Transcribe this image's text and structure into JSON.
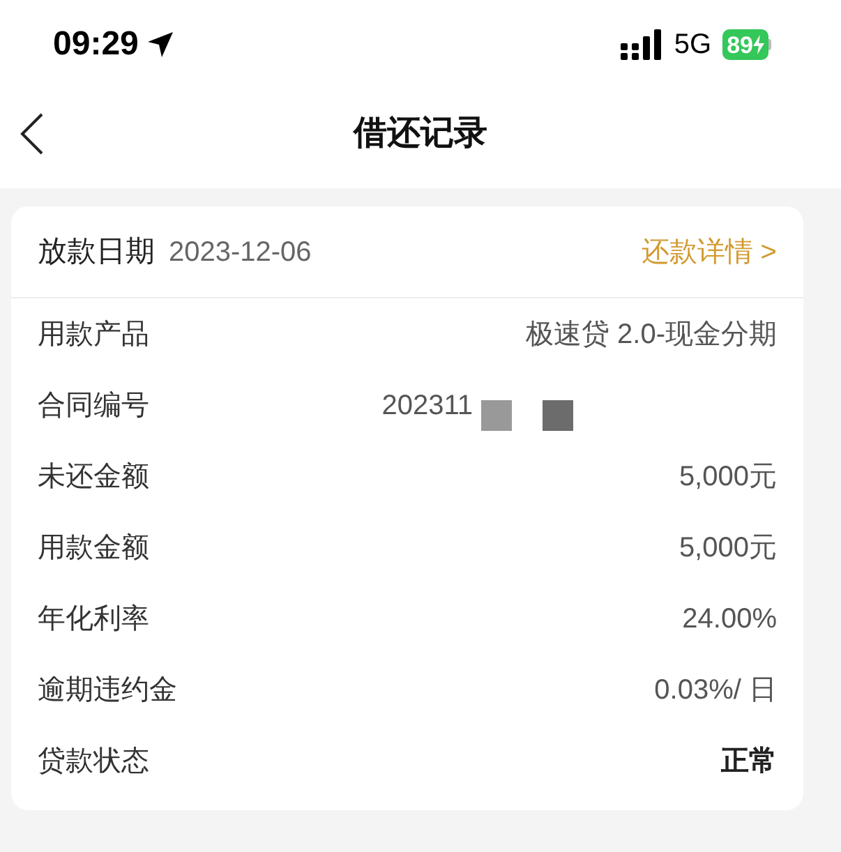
{
  "status_bar": {
    "time": "09:29",
    "network": "5G",
    "battery": "89"
  },
  "nav": {
    "title": "借还记录"
  },
  "card": {
    "date_label": "放款日期",
    "date": "2023-12-06",
    "link": "还款详情 >",
    "rows": [
      {
        "label": "用款产品",
        "value": "极速贷 2.0-现金分期",
        "kind": "plain"
      },
      {
        "label": "合同编号",
        "value": "202311",
        "kind": "redacted"
      },
      {
        "label": "未还金额",
        "value": "5,000元",
        "kind": "plain"
      },
      {
        "label": "用款金额",
        "value": "5,000元",
        "kind": "plain"
      },
      {
        "label": "年化利率",
        "value": "24.00%",
        "kind": "plain"
      },
      {
        "label": "逾期违约金",
        "value": "0.03%/ 日",
        "kind": "plain"
      },
      {
        "label": "贷款状态",
        "value": "正常",
        "kind": "strong"
      }
    ]
  }
}
